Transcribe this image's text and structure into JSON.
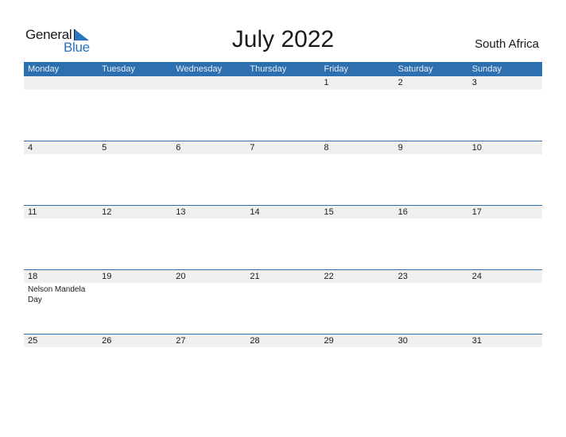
{
  "logo": {
    "word1": "General",
    "word2": "Blue",
    "icon": "triangle-flag-icon"
  },
  "title": "July 2022",
  "country": "South Africa",
  "colors": {
    "header_bg": "#2e6fb0",
    "date_strip": "#f0f0f0",
    "accent": "#2a74c0"
  },
  "weekdays": [
    "Monday",
    "Tuesday",
    "Wednesday",
    "Thursday",
    "Friday",
    "Saturday",
    "Sunday"
  ],
  "weeks": [
    {
      "days": [
        {
          "num": "",
          "event": ""
        },
        {
          "num": "",
          "event": ""
        },
        {
          "num": "",
          "event": ""
        },
        {
          "num": "",
          "event": ""
        },
        {
          "num": "1",
          "event": ""
        },
        {
          "num": "2",
          "event": ""
        },
        {
          "num": "3",
          "event": ""
        }
      ]
    },
    {
      "days": [
        {
          "num": "4",
          "event": ""
        },
        {
          "num": "5",
          "event": ""
        },
        {
          "num": "6",
          "event": ""
        },
        {
          "num": "7",
          "event": ""
        },
        {
          "num": "8",
          "event": ""
        },
        {
          "num": "9",
          "event": ""
        },
        {
          "num": "10",
          "event": ""
        }
      ]
    },
    {
      "days": [
        {
          "num": "11",
          "event": ""
        },
        {
          "num": "12",
          "event": ""
        },
        {
          "num": "13",
          "event": ""
        },
        {
          "num": "14",
          "event": ""
        },
        {
          "num": "15",
          "event": ""
        },
        {
          "num": "16",
          "event": ""
        },
        {
          "num": "17",
          "event": ""
        }
      ]
    },
    {
      "days": [
        {
          "num": "18",
          "event": "Nelson Mandela Day"
        },
        {
          "num": "19",
          "event": ""
        },
        {
          "num": "20",
          "event": ""
        },
        {
          "num": "21",
          "event": ""
        },
        {
          "num": "22",
          "event": ""
        },
        {
          "num": "23",
          "event": ""
        },
        {
          "num": "24",
          "event": ""
        }
      ]
    },
    {
      "days": [
        {
          "num": "25",
          "event": ""
        },
        {
          "num": "26",
          "event": ""
        },
        {
          "num": "27",
          "event": ""
        },
        {
          "num": "28",
          "event": ""
        },
        {
          "num": "29",
          "event": ""
        },
        {
          "num": "30",
          "event": ""
        },
        {
          "num": "31",
          "event": ""
        }
      ]
    }
  ]
}
